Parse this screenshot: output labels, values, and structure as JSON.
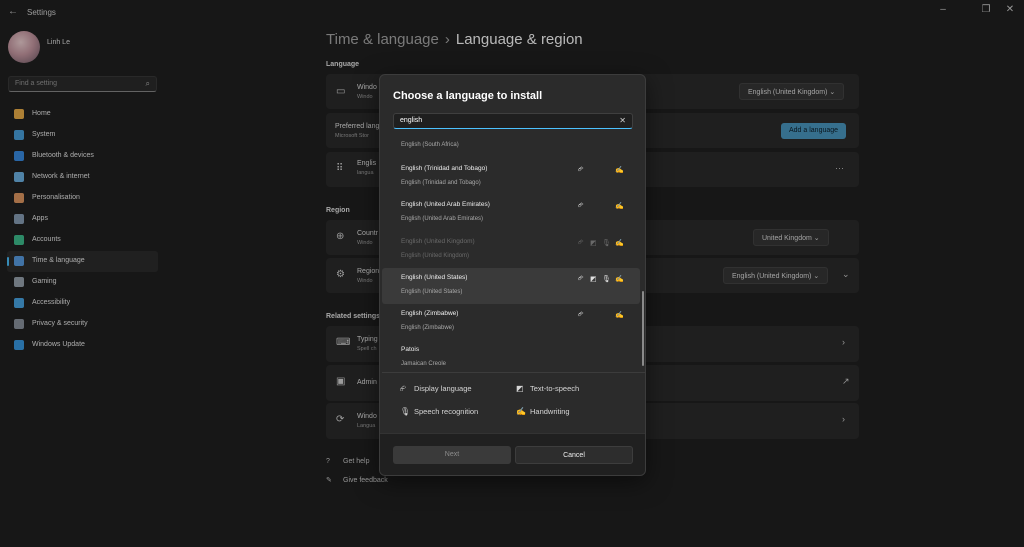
{
  "window": {
    "title": "Settings",
    "back_glyph": "←",
    "min_glyph": "–",
    "max_glyph": "❐",
    "close_glyph": "✕"
  },
  "profile": {
    "name": "Linh Le"
  },
  "search": {
    "placeholder": "Find a setting",
    "icon": "search-icon",
    "glyph": "⌕"
  },
  "sidebar": {
    "items": [
      {
        "label": "Home",
        "icon": "home-icon",
        "color": "#f0b24a"
      },
      {
        "label": "System",
        "icon": "system-icon",
        "color": "#4aa3df"
      },
      {
        "label": "Bluetooth & devices",
        "icon": "bluetooth-icon",
        "color": "#3a8ee6"
      },
      {
        "label": "Network & internet",
        "icon": "network-icon",
        "color": "#6fb6e8"
      },
      {
        "label": "Personalisation",
        "icon": "personalisation-icon",
        "color": "#e39a63"
      },
      {
        "label": "Apps",
        "icon": "apps-icon",
        "color": "#8aa0b8"
      },
      {
        "label": "Accounts",
        "icon": "accounts-icon",
        "color": "#3fbf8f"
      },
      {
        "label": "Time & language",
        "icon": "time-language-icon",
        "color": "#5aa0e6"
      },
      {
        "label": "Gaming",
        "icon": "gaming-icon",
        "color": "#9aa5b1"
      },
      {
        "label": "Accessibility",
        "icon": "accessibility-icon",
        "color": "#4aa8e8"
      },
      {
        "label": "Privacy & security",
        "icon": "shield-icon",
        "color": "#8c95a0"
      },
      {
        "label": "Windows Update",
        "icon": "windows-update-icon",
        "color": "#3a9be6"
      }
    ],
    "active_index": 7
  },
  "breadcrumb": {
    "parent": "Time & language",
    "separator": "›",
    "current": "Language & region"
  },
  "sections": {
    "language": "Language",
    "region": "Region",
    "related": "Related settings"
  },
  "cards": {
    "windows_display": {
      "title": "Windo",
      "sub": "Windo",
      "dropdown": "English (United Kingdom)",
      "chevron": "⌄"
    },
    "preferred": {
      "title": "Preferred lang",
      "sub": "Microsoft Stor",
      "button": "Add a language"
    },
    "english_item": {
      "title": "Englis",
      "sub": "langua",
      "more": "···"
    },
    "country": {
      "title": "Countr",
      "sub": "Windo",
      "dropdown": "United Kingdom",
      "chevron": "⌄"
    },
    "regional": {
      "title": "Region",
      "sub": "Windo",
      "dropdown": "English (United Kingdom)",
      "chevron": "⌄",
      "expand": "⌄"
    },
    "typing": {
      "title": "Typing",
      "sub": "Spell ch",
      "arrow": "›"
    },
    "admin": {
      "title": "Admin",
      "arrow": "↗"
    },
    "windows_backup": {
      "title": "Windo",
      "sub": "Langua",
      "arrow": "›"
    }
  },
  "help_links": [
    {
      "label": "Get help",
      "icon": "help-icon",
      "glyph": "?"
    },
    {
      "label": "Give feedback",
      "icon": "feedback-icon",
      "glyph": "✎"
    }
  ],
  "dialog": {
    "title": "Choose a language to install",
    "search_value": "english",
    "clear_glyph": "✕",
    "languages": [
      {
        "name": "",
        "native": "English (South Africa)",
        "features": [],
        "state": "normal"
      },
      {
        "name": "English (Trinidad and Tobago)",
        "native": "English (Trinidad and Tobago)",
        "features": [
          "display",
          "handwriting"
        ],
        "state": "normal"
      },
      {
        "name": "English (United Arab Emirates)",
        "native": "English (United Arab Emirates)",
        "features": [
          "display",
          "handwriting"
        ],
        "state": "normal"
      },
      {
        "name": "English (United Kingdom)",
        "native": "English (United Kingdom)",
        "features": [
          "display",
          "tts",
          "speech",
          "handwriting"
        ],
        "state": "disabled"
      },
      {
        "name": "English (United States)",
        "native": "English (United States)",
        "features": [
          "display",
          "tts",
          "speech",
          "handwriting"
        ],
        "state": "hover"
      },
      {
        "name": "English (Zimbabwe)",
        "native": "English (Zimbabwe)",
        "features": [
          "display",
          "handwriting"
        ],
        "state": "normal"
      },
      {
        "name": "Patois",
        "native": "Jamaican Creole",
        "features": [],
        "state": "normal"
      }
    ],
    "legend": {
      "display": "Display language",
      "tts": "Text-to-speech",
      "speech": "Speech recognition",
      "handwriting": "Handwriting"
    },
    "buttons": {
      "next": "Next",
      "cancel": "Cancel"
    }
  },
  "icon_glyphs": {
    "display": "⮳",
    "tts": "◩",
    "speech": "🎙",
    "handwriting": "✍"
  }
}
